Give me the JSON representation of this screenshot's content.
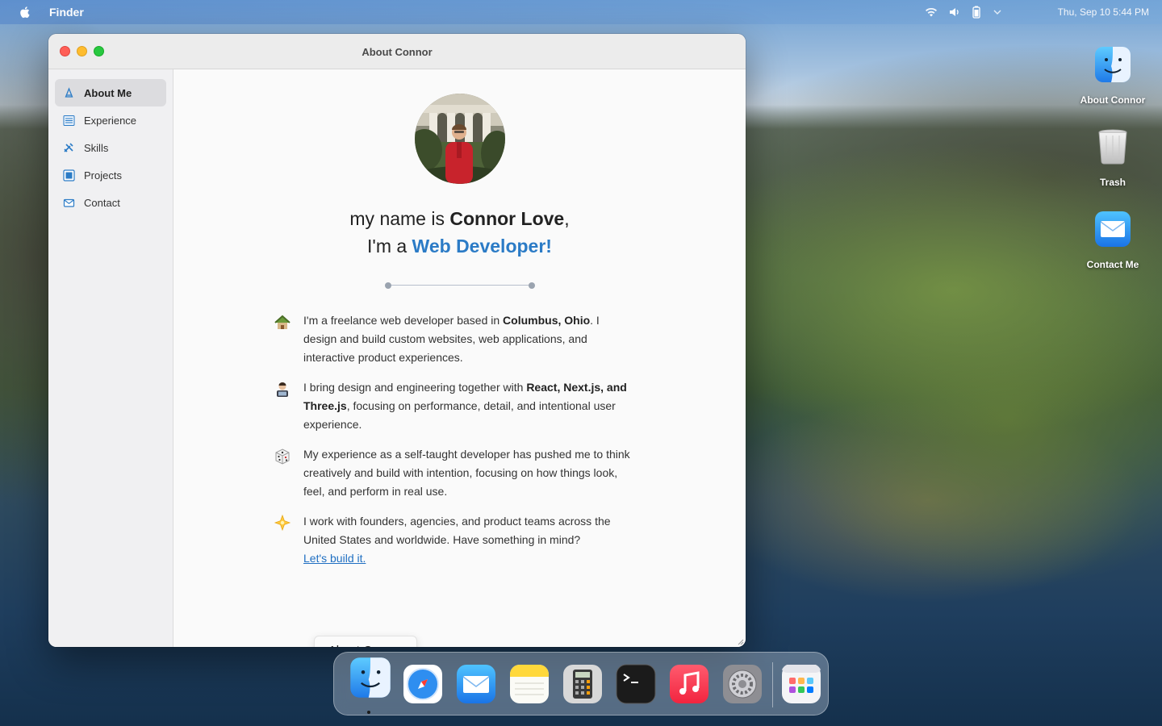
{
  "menubar": {
    "app_name": "Finder",
    "clock": "Thu, Sep 10 5:44 PM",
    "status_icons": [
      "wifi-icon",
      "volume-icon",
      "battery-icon",
      "control-center-icon"
    ]
  },
  "desktop": {
    "icons": [
      {
        "label": "About Connor",
        "icon": "finder-icon"
      },
      {
        "label": "Trash",
        "icon": "trash-icon"
      },
      {
        "label": "Contact Me",
        "icon": "mail-icon"
      }
    ]
  },
  "window": {
    "title": "About Connor",
    "sidebar": {
      "items": [
        {
          "label": "About Me",
          "icon": "person-icon",
          "active": true
        },
        {
          "label": "Experience",
          "icon": "list-icon",
          "active": false
        },
        {
          "label": "Skills",
          "icon": "tools-icon",
          "active": false
        },
        {
          "label": "Projects",
          "icon": "square-icon",
          "active": false
        },
        {
          "label": "Contact",
          "icon": "envelope-icon",
          "active": false
        }
      ]
    },
    "content": {
      "headline_line1_prefix": "my name is ",
      "headline_line1_name": "Connor Love",
      "headline_line1_suffix": ",",
      "headline_line2_prefix": "I'm a ",
      "headline_line2_role": "Web Developer!",
      "paragraphs": [
        {
          "emoji": "house-emoji",
          "t1": "I'm a freelance web developer based in ",
          "b1": "Columbus, Ohio",
          "t2": ". I design and build custom websites, web applications, and interactive product experiences."
        },
        {
          "emoji": "technologist-emoji",
          "t1": "I bring design and engineering together with ",
          "b1": "React, Next.js, and Three.js",
          "t2": ", focusing on performance, detail, and intentional user experience."
        },
        {
          "emoji": "dice-emoji",
          "t1": "My experience as a self-taught developer has pushed me to think creatively and build with intention, focusing on how things look, feel, and perform in real use."
        },
        {
          "emoji": "sparkle-emoji",
          "t1": "I work with founders, agencies, and product teams across the United States and worldwide. Have something in mind?",
          "link": "Let's build it."
        }
      ],
      "tooltip": "About Connor"
    }
  },
  "dock": {
    "apps": [
      "Finder",
      "Safari",
      "Mail",
      "Notes",
      "Calculator",
      "Terminal",
      "Music",
      "System Preferences",
      "Launchpad"
    ]
  },
  "colors": {
    "accent": "#2b7bc6",
    "link": "#1f6fc2",
    "close": "#ff5f57",
    "minimize": "#febc2e",
    "maximize": "#28c840"
  }
}
